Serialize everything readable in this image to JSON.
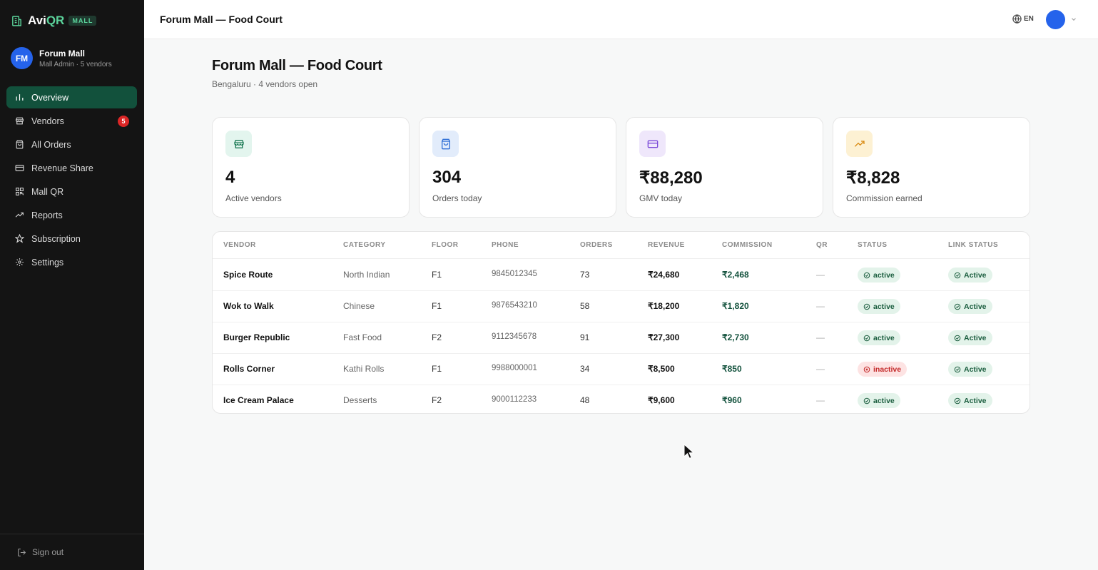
{
  "brand": {
    "name_prefix": "Avi",
    "name_suffix": "QR",
    "tag": "MALL"
  },
  "profile": {
    "initials": "FM",
    "name": "Forum Mall",
    "role": "Mall Admin · 5 vendors"
  },
  "nav": [
    {
      "label": "Overview",
      "icon": "bar-chart-icon",
      "active": true
    },
    {
      "label": "Vendors",
      "icon": "store-icon",
      "badge": "5"
    },
    {
      "label": "All Orders",
      "icon": "shopping-bag-icon"
    },
    {
      "label": "Revenue Share",
      "icon": "credit-card-icon"
    },
    {
      "label": "Mall QR",
      "icon": "qr-code-icon"
    },
    {
      "label": "Reports",
      "icon": "trending-up-icon"
    },
    {
      "label": "Subscription",
      "icon": "star-icon"
    },
    {
      "label": "Settings",
      "icon": "gear-icon"
    }
  ],
  "signout": "Sign out",
  "topbar": {
    "title": "Forum Mall — Food Court",
    "lang": "EN"
  },
  "page": {
    "title": "Forum Mall — Food Court",
    "subtitle": "Bengaluru · 4 vendors open"
  },
  "stats": [
    {
      "value": "4",
      "label": "Active vendors",
      "icon": "store-icon",
      "color": "#1b7a55",
      "bg": "#e3f5ee"
    },
    {
      "value": "304",
      "label": "Orders today",
      "icon": "shopping-bag-icon",
      "color": "#2f6fd6",
      "bg": "#e2ecfb"
    },
    {
      "value": "₹88,280",
      "label": "GMV today",
      "icon": "credit-card-icon",
      "color": "#7c4bd8",
      "bg": "#efe7fb"
    },
    {
      "value": "₹8,828",
      "label": "Commission earned",
      "icon": "trending-up-icon",
      "color": "#d98a12",
      "bg": "#fdf1d3"
    }
  ],
  "table": {
    "headers": [
      "VENDOR",
      "CATEGORY",
      "FLOOR",
      "PHONE",
      "ORDERS",
      "REVENUE",
      "COMMISSION",
      "QR",
      "STATUS",
      "LINK STATUS"
    ],
    "rows": [
      {
        "vendor": "Spice Route",
        "category": "North Indian",
        "floor": "F1",
        "phone": "9845012345",
        "orders": "73",
        "revenue": "₹24,680",
        "commission": "₹2,468",
        "qr": "—",
        "status": "active",
        "link_status": "Active"
      },
      {
        "vendor": "Wok to Walk",
        "category": "Chinese",
        "floor": "F1",
        "phone": "9876543210",
        "orders": "58",
        "revenue": "₹18,200",
        "commission": "₹1,820",
        "qr": "—",
        "status": "active",
        "link_status": "Active"
      },
      {
        "vendor": "Burger Republic",
        "category": "Fast Food",
        "floor": "F2",
        "phone": "9112345678",
        "orders": "91",
        "revenue": "₹27,300",
        "commission": "₹2,730",
        "qr": "—",
        "status": "active",
        "link_status": "Active"
      },
      {
        "vendor": "Rolls Corner",
        "category": "Kathi Rolls",
        "floor": "F1",
        "phone": "9988000001",
        "orders": "34",
        "revenue": "₹8,500",
        "commission": "₹850",
        "qr": "—",
        "status": "inactive",
        "link_status": "Active"
      },
      {
        "vendor": "Ice Cream Palace",
        "category": "Desserts",
        "floor": "F2",
        "phone": "9000112233",
        "orders": "48",
        "revenue": "₹9,600",
        "commission": "₹960",
        "qr": "—",
        "status": "active",
        "link_status": "Active"
      }
    ]
  },
  "colors": {
    "sidebar_bg": "#141414",
    "active_nav": "#12513c",
    "accent_green": "#5bd39b",
    "avatar_blue": "#2563eb",
    "badge_red": "#dc2626"
  }
}
